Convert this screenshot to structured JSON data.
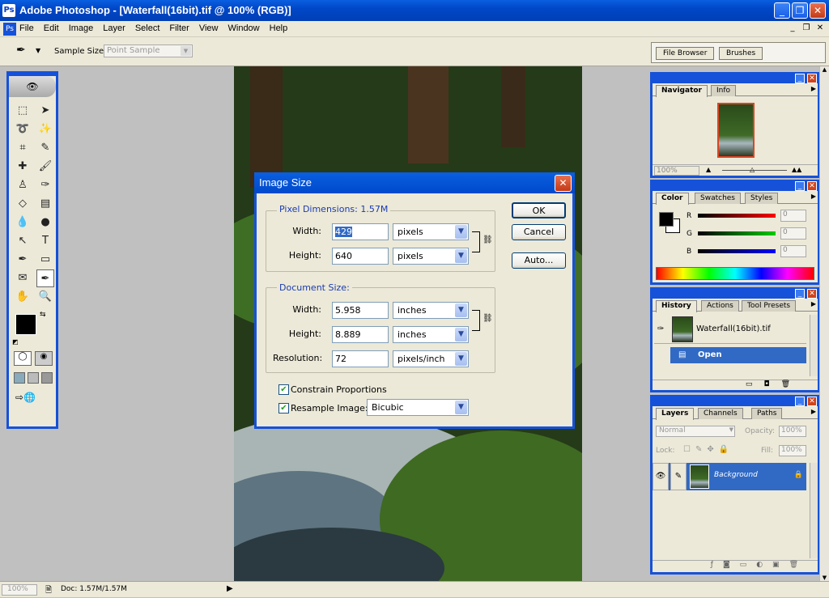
{
  "window": {
    "title": "Adobe Photoshop - [Waterfall(16bit).tif @ 100% (RGB)]",
    "app_icon": "Ps"
  },
  "menu": [
    "File",
    "Edit",
    "Image",
    "Layer",
    "Select",
    "Filter",
    "View",
    "Window",
    "Help"
  ],
  "options": {
    "sample_label": "Sample Size:",
    "sample_value": "Point Sample"
  },
  "palette_well": {
    "tabs": [
      "File Browser",
      "Brushes"
    ]
  },
  "navigator": {
    "tabs": [
      "Navigator",
      "Info"
    ],
    "zoom": "100%"
  },
  "color": {
    "tabs": [
      "Color",
      "Swatches",
      "Styles"
    ],
    "channels": [
      {
        "label": "R",
        "value": "0"
      },
      {
        "label": "G",
        "value": "0"
      },
      {
        "label": "B",
        "value": "0"
      }
    ]
  },
  "history": {
    "tabs": [
      "History",
      "Actions",
      "Tool Presets"
    ],
    "snapshot": "Waterfall(16bit).tif",
    "step": "Open"
  },
  "layers": {
    "tabs": [
      "Layers",
      "Channels",
      "Paths"
    ],
    "mode": "Normal",
    "opacity_label": "Opacity:",
    "opacity": "100%",
    "lock_label": "Lock:",
    "fill_label": "Fill:",
    "fill": "100%",
    "layer_name": "Background"
  },
  "dialog": {
    "title": "Image Size",
    "pixel_dimensions": {
      "label": "Pixel Dimensions:",
      "size": "1.57M",
      "width_label": "Width:",
      "width": "429",
      "width_unit": "pixels",
      "height_label": "Height:",
      "height": "640",
      "height_unit": "pixels"
    },
    "document_size": {
      "label": "Document Size:",
      "width_label": "Width:",
      "width": "5.958",
      "width_unit": "inches",
      "height_label": "Height:",
      "height": "8.889",
      "height_unit": "inches",
      "resolution_label": "Resolution:",
      "resolution": "72",
      "resolution_unit": "pixels/inch"
    },
    "constrain_label": "Constrain Proportions",
    "resample_label": "Resample Image:",
    "resample_method": "Bicubic",
    "ok": "OK",
    "cancel": "Cancel",
    "auto": "Auto..."
  },
  "status": {
    "zoom": "100%",
    "doc": "Doc: 1.57M/1.57M"
  }
}
